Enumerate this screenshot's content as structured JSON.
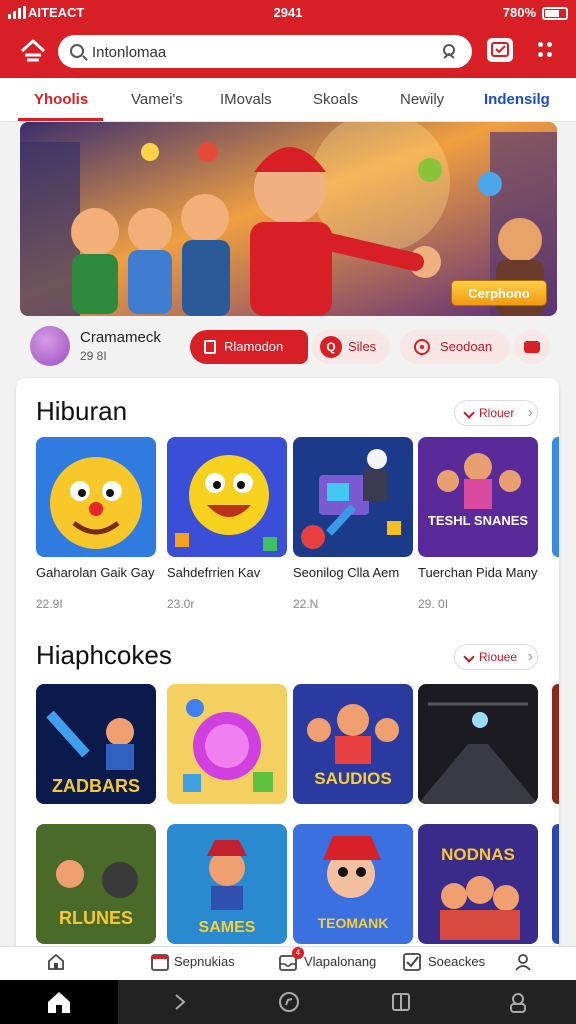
{
  "status": {
    "carrier": "AITEACT",
    "time": "2941",
    "battery": "780%"
  },
  "search": {
    "value": "Intonlomaa",
    "placeholder": ""
  },
  "tabs": [
    {
      "label": "Yhoolis",
      "active": true
    },
    {
      "label": "Vamei's",
      "active": false
    },
    {
      "label": "IMovals",
      "active": false
    },
    {
      "label": "Skoals",
      "active": false
    },
    {
      "label": "Newily",
      "active": false
    },
    {
      "label": "Indensilg",
      "active": false
    }
  ],
  "banner": {
    "button_label": "Cerphono"
  },
  "channel": {
    "name": "Cramameck",
    "count": "29 8I",
    "pills": {
      "primary": "Rlamodon",
      "secondary": "Siles",
      "tertiary": "Seodoan"
    }
  },
  "sections": [
    {
      "title": "Hiburan",
      "more_label": "Rlouer",
      "items": [
        {
          "title": "Gaharolan Gaik Gay",
          "meta": "22.9I"
        },
        {
          "title": "Sahdefrrien Kav",
          "meta": "23.0r"
        },
        {
          "title": "Seonilog Clla Aem",
          "meta": "22.N"
        },
        {
          "title": "Tuerchan Pida Many",
          "meta": "29. 0I"
        }
      ]
    },
    {
      "title": "Hiaphcokes",
      "more_label": "Riouee",
      "items": [
        {
          "title": "ZADBARS",
          "meta": ""
        },
        {
          "title": "",
          "meta": ""
        },
        {
          "title": "SAUDIOS",
          "meta": ""
        },
        {
          "title": "",
          "meta": ""
        }
      ],
      "row2": [
        {
          "title": "RLUNES",
          "meta": ""
        },
        {
          "title": "SAMES",
          "meta": ""
        },
        {
          "title": "TEOMANK",
          "meta": ""
        },
        {
          "title": "NODNAS",
          "meta": ""
        }
      ]
    }
  ],
  "tile_art": [
    "TESHL SNANES",
    "ZADBARS",
    "SAUDIOS",
    "RLUNES",
    "SAMES",
    "TEOMANK",
    "NODNAS"
  ],
  "bottom_nav": [
    {
      "label": "",
      "icon": "home-outline-icon"
    },
    {
      "label": "Sepnukias",
      "icon": "calendar-icon"
    },
    {
      "label": "Vlapalonang",
      "icon": "inbox-icon",
      "badge": "4"
    },
    {
      "label": "Soeackes",
      "icon": "checkbox-icon"
    },
    {
      "label": "",
      "icon": "profile-icon"
    }
  ],
  "colors": {
    "brand": "#d81f26",
    "accent_blue": "#1a4fc4",
    "gold": "#f0a010"
  }
}
